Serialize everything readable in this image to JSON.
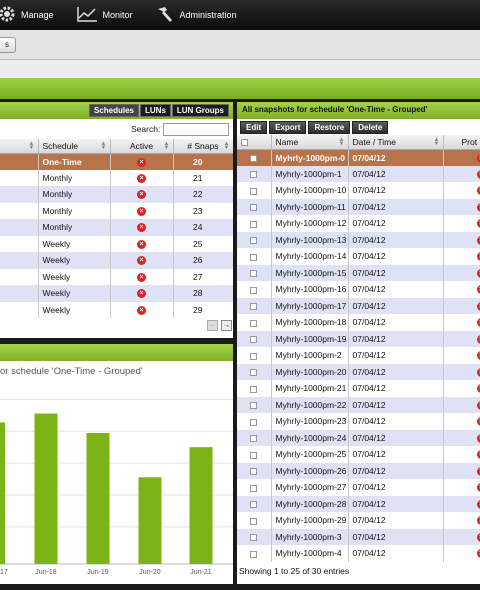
{
  "nav": {
    "items": [
      {
        "label": "Manage",
        "icon": "gear-icon"
      },
      {
        "label": "Monitor",
        "icon": "chart-icon"
      },
      {
        "label": "Administration",
        "icon": "hammer-icon"
      }
    ],
    "subtab": "s"
  },
  "schedules_panel": {
    "tabs": [
      "Schedules",
      "LUNs",
      "LUN Groups"
    ],
    "search_label": "Search:",
    "search_value": "",
    "columns": [
      "Schedule",
      "Active",
      "# Snaps"
    ],
    "rows": [
      {
        "schedule": "One-Time",
        "snaps": "20",
        "selected": true
      },
      {
        "schedule": "Monthly",
        "snaps": "21"
      },
      {
        "schedule": "Monthly",
        "snaps": "22"
      },
      {
        "schedule": "Monthly",
        "snaps": "23"
      },
      {
        "schedule": "Monthly",
        "snaps": "24"
      },
      {
        "schedule": "Weekly",
        "snaps": "25"
      },
      {
        "schedule": "Weekly",
        "snaps": "26"
      },
      {
        "schedule": "Weekly",
        "snaps": "27"
      },
      {
        "schedule": "Weekly",
        "snaps": "28"
      },
      {
        "schedule": "Weekly",
        "snaps": "29"
      }
    ]
  },
  "chart_panel": {
    "title": "or schedule 'One-Time - Grouped'"
  },
  "chart_data": {
    "type": "bar",
    "categories": [
      "17",
      "Jun-18",
      "Jun-19",
      "Jun-20",
      "Jun-21"
    ],
    "values": [
      80,
      85,
      74,
      49,
      66
    ],
    "ylim": [
      0,
      100
    ],
    "bar_color": "#7cb316"
  },
  "snapshots_panel": {
    "title": "All snapshots for schedule 'One-Time - Grouped'",
    "buttons": [
      "Edit",
      "Export",
      "Restore",
      "Delete"
    ],
    "columns": [
      "Name",
      "Date / Time",
      "Prot"
    ],
    "rows": [
      {
        "name": "Myhrly-1000pm-0",
        "date": "07/04/12",
        "selected": true
      },
      {
        "name": "Myhrly-1000pm-1",
        "date": "07/04/12"
      },
      {
        "name": "Myhrly-1000pm-10",
        "date": "07/04/12"
      },
      {
        "name": "Myhrly-1000pm-11",
        "date": "07/04/12"
      },
      {
        "name": "Myhrly-1000pm-12",
        "date": "07/04/12"
      },
      {
        "name": "Myhrly-1000pm-13",
        "date": "07/04/12"
      },
      {
        "name": "Myhrly-1000pm-14",
        "date": "07/04/12"
      },
      {
        "name": "Myhrly-1000pm-15",
        "date": "07/04/12"
      },
      {
        "name": "Myhrly-1000pm-16",
        "date": "07/04/12"
      },
      {
        "name": "Myhrly-1000pm-17",
        "date": "07/04/12"
      },
      {
        "name": "Myhrly-1000pm-18",
        "date": "07/04/12"
      },
      {
        "name": "Myhrly-1000pm-19",
        "date": "07/04/12"
      },
      {
        "name": "Myhrly-1000pm-2",
        "date": "07/04/12"
      },
      {
        "name": "Myhrly-1000pm-20",
        "date": "07/04/12"
      },
      {
        "name": "Myhrly-1000pm-21",
        "date": "07/04/12"
      },
      {
        "name": "Myhrly-1000pm-22",
        "date": "07/04/12"
      },
      {
        "name": "Myhrly-1000pm-23",
        "date": "07/04/12"
      },
      {
        "name": "Myhrly-1000pm-24",
        "date": "07/04/12"
      },
      {
        "name": "Myhrly-1000pm-25",
        "date": "07/04/12"
      },
      {
        "name": "Myhrly-1000pm-26",
        "date": "07/04/12"
      },
      {
        "name": "Myhrly-1000pm-27",
        "date": "07/04/12"
      },
      {
        "name": "Myhrly-1000pm-28",
        "date": "07/04/12"
      },
      {
        "name": "Myhrly-1000pm-29",
        "date": "07/04/12"
      },
      {
        "name": "Myhrly-1000pm-3",
        "date": "07/04/12"
      },
      {
        "name": "Myhrly-1000pm-4",
        "date": "07/04/12"
      }
    ],
    "footer": "Showing 1 to 25 of 30 entries"
  }
}
